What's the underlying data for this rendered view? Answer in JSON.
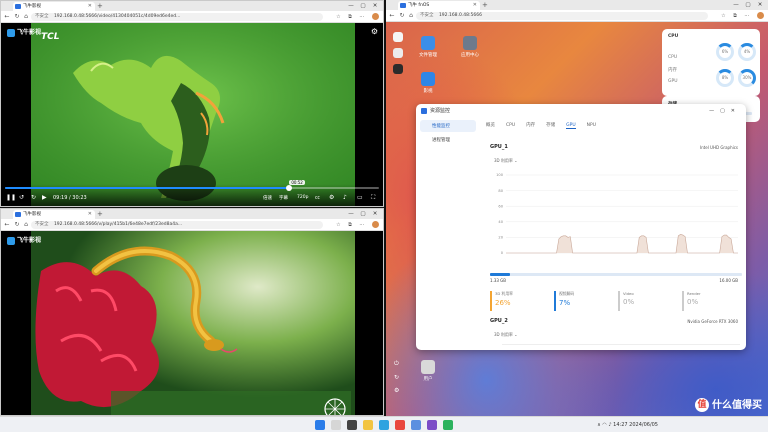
{
  "top_browser": {
    "tab_title": "飞牛影视",
    "not_secure": "不安全",
    "url": "192.168.0.48:5666/video/4130404051c/4d09ed6e4ed...",
    "video": {
      "logo_text": "飞牛影视",
      "channel_text": "TCL",
      "time": "09:19 / 30:23",
      "quality": "720p",
      "speed_label": "倍速",
      "subtitle_label": "字幕",
      "progress_percent": 76,
      "tooltip": "00:52"
    }
  },
  "bottom_browser": {
    "tab_title": "飞牛影视",
    "not_secure": "不安全",
    "url": "192.168.0.48:5666/v/play/415b1/6e48e7edf/23ed8a4a...",
    "video": {
      "logo_text": "飞牛影视"
    }
  },
  "desktop": {
    "tab_title": "飞牛 fnOS",
    "not_secure": "不安全",
    "url": "192.168.0.48:5666",
    "file_tab": "文件",
    "icons": [
      {
        "label": "文件管理",
        "color": "#3b8ee8"
      },
      {
        "label": "应用中心",
        "color": "#6d7a8c"
      },
      {
        "label": "影视",
        "color": "#2f86e6"
      }
    ],
    "widget": {
      "title": "CPU",
      "line1": "CPU",
      "line2": "内存",
      "line3": "GPU",
      "rings": [
        {
          "label": "6%",
          "value": 6
        },
        {
          "label": "4%",
          "value": 4
        },
        {
          "label": "8%",
          "value": 8
        },
        {
          "label": "30%",
          "value": 30
        }
      ]
    },
    "widget2": {
      "title": "存储"
    },
    "bottom_folder": "用户"
  },
  "monitor": {
    "title": "资源监控",
    "window_controls": [
      "—",
      "▢",
      "✕"
    ],
    "nav": [
      "性能监控",
      "进程管理"
    ],
    "tabs": [
      "概览",
      "CPU",
      "内存",
      "存储",
      "GPU",
      "NPU"
    ],
    "active_tab": "GPU",
    "gpu1": {
      "name": "GPU_1",
      "model": "Intel UHD Graphics",
      "engine": "3D 利用率",
      "mem_used": "1.33 GB",
      "mem_total": "16.00 GB",
      "mem_percent": 8,
      "stats": [
        {
          "label": "3D 利用率",
          "value": "26%"
        },
        {
          "label": "视频解码",
          "value": "7%"
        },
        {
          "label": "Video",
          "value": "0%"
        },
        {
          "label": "Render",
          "value": "0%"
        }
      ]
    },
    "gpu2": {
      "name": "GPU_2",
      "model": "Nvidia GeForce RTX 3060",
      "engine": "3D 利用率"
    }
  },
  "chart_data": {
    "type": "area",
    "title": "",
    "xlabel": "",
    "ylabel": "",
    "ylim": [
      0,
      100
    ],
    "y_ticks": [
      "100",
      "80",
      "60",
      "40",
      "20",
      "0"
    ],
    "series": [
      {
        "name": "",
        "values": [
          0,
          0,
          0,
          0,
          0,
          0,
          0,
          0,
          0,
          0,
          0,
          0,
          0,
          0,
          0,
          0,
          0,
          0,
          0,
          0,
          0,
          0,
          0,
          18,
          21,
          22,
          22,
          20,
          21,
          0,
          0,
          0,
          0,
          0,
          0,
          0,
          0,
          0,
          0,
          0,
          0,
          0,
          0,
          0,
          0,
          0,
          0,
          0,
          0,
          0,
          0,
          0,
          0,
          0,
          0,
          0,
          0,
          0,
          20,
          22,
          22,
          20,
          0,
          0,
          0,
          0,
          0,
          0,
          0,
          0,
          0,
          0,
          0,
          0,
          0,
          22,
          24,
          23,
          21,
          0,
          0,
          0,
          0,
          0,
          0,
          0,
          0,
          0,
          0,
          0,
          0,
          0,
          0,
          0,
          21,
          23,
          23,
          20,
          18,
          0,
          0,
          0
        ]
      }
    ],
    "grid": true,
    "fill_color": "#f0e1d8",
    "line_color": "#c9a899"
  },
  "taskbar": {
    "time": "14:27",
    "date": "2024/06/05"
  },
  "watermark": "什么值得买",
  "watermark_icon": "值"
}
